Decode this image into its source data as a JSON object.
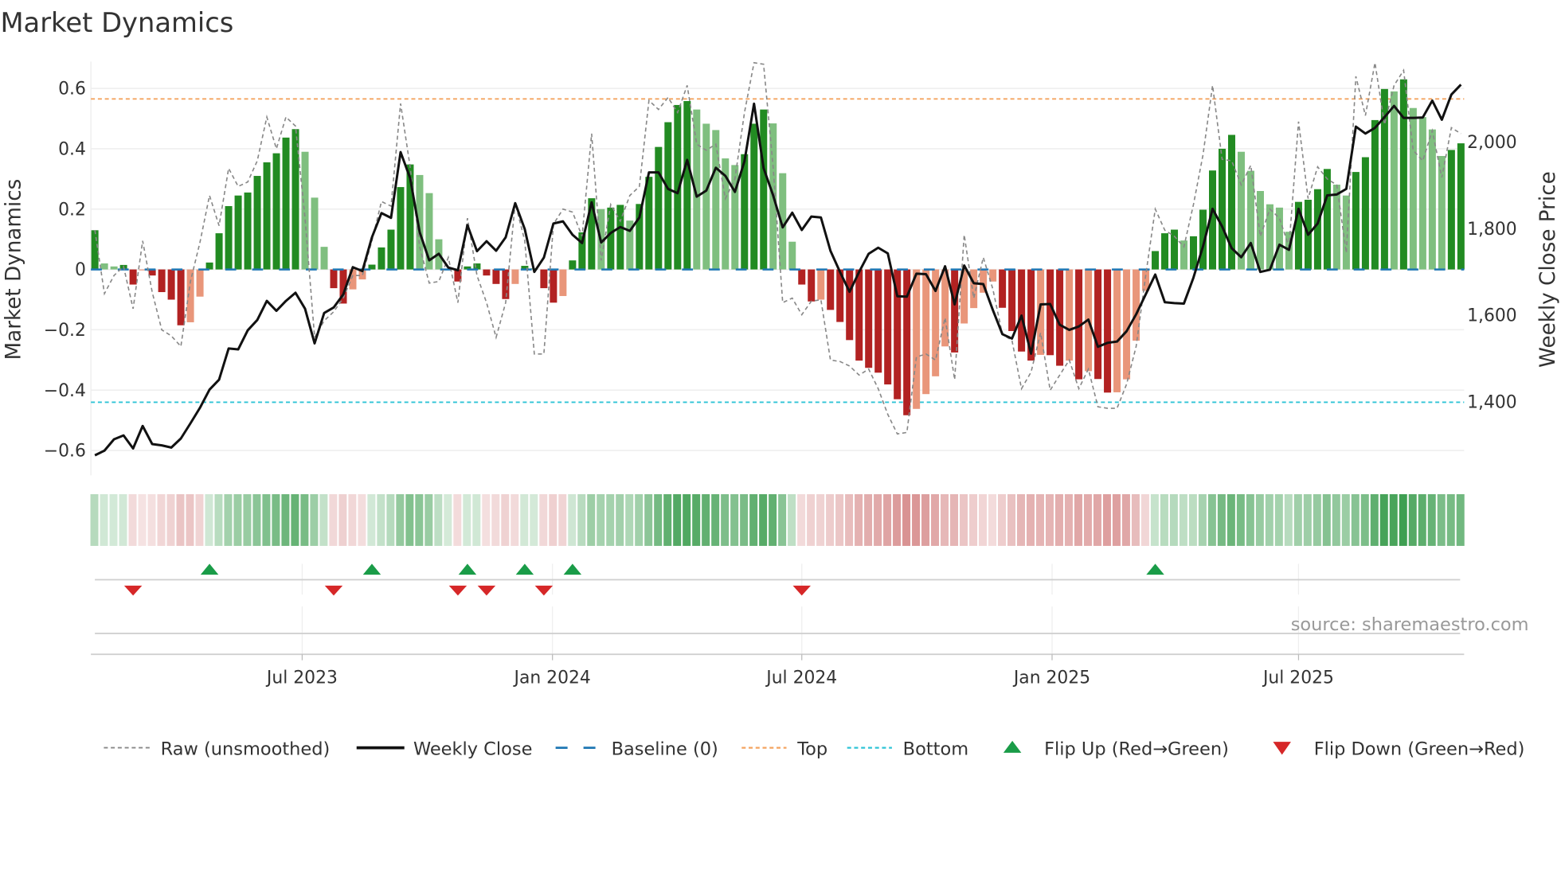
{
  "title": "Market Dynamics",
  "source": "source: sharemaestro.com",
  "colors": {
    "pos_strong": "#228b22",
    "pos_weak": "#7fbf7f",
    "neg_strong": "#b22222",
    "neg_weak": "#e9967a",
    "raw": "#888888",
    "close": "#111111",
    "baseline": "#1f77b4",
    "top": "#f4a460",
    "bottom": "#2ec4d6",
    "flip_up": "#1a9c48",
    "flip_down": "#d62728",
    "heat_pos": "#3f9f52",
    "heat_neg": "#c96464"
  },
  "legend": [
    {
      "key": "raw",
      "label": "Raw (unsmoothed)"
    },
    {
      "key": "close",
      "label": "Weekly Close"
    },
    {
      "key": "baseline",
      "label": "Baseline (0)"
    },
    {
      "key": "top",
      "label": "Top"
    },
    {
      "key": "bottom",
      "label": "Bottom"
    },
    {
      "key": "flip_up",
      "label": "Flip Up (Red→Green)"
    },
    {
      "key": "flip_down",
      "label": "Flip Down (Green→Red)"
    }
  ],
  "chart_data": {
    "type": "bar",
    "title": "Market Dynamics",
    "ylabel": "Market Dynamics",
    "y2label": "Weekly Close Price",
    "ylim": [
      -0.66,
      0.68
    ],
    "y_ticks": [
      "0.6",
      "0.4",
      "0.2",
      "0",
      "−0.2",
      "−0.4",
      "−0.6"
    ],
    "y_tick_values": [
      0.6,
      0.4,
      0.2,
      0,
      -0.2,
      -0.4,
      -0.6
    ],
    "y2_ticks": [
      "2,000",
      "1,800",
      "1,600",
      "1,400"
    ],
    "y2_tick_values": [
      2000,
      1800,
      1600,
      1400
    ],
    "x_ticks": [
      {
        "label": "Jul 2023",
        "week": 21.7
      },
      {
        "label": "Jan 2024",
        "week": 47.9
      },
      {
        "label": "Jul 2024",
        "week": 74.0
      },
      {
        "label": "Jan 2025",
        "week": 100.2
      },
      {
        "label": "Jul 2025",
        "week": 126.0
      }
    ],
    "top_level": 0.565,
    "bottom_level": -0.44,
    "baseline": 0,
    "grid": true,
    "legend_position": "bottom",
    "momentum": [
      0.13,
      0.02,
      0.01,
      0.015,
      -0.05,
      -0.003,
      -0.02,
      -0.075,
      -0.1,
      -0.185,
      -0.175,
      -0.09,
      0.023,
      0.12,
      0.21,
      0.245,
      0.255,
      0.31,
      0.355,
      0.385,
      0.437,
      0.465,
      0.39,
      0.238,
      0.075,
      -0.062,
      -0.113,
      -0.066,
      -0.033,
      0.016,
      0.073,
      0.132,
      0.273,
      0.348,
      0.313,
      0.253,
      0.1,
      0.003,
      -0.04,
      0.01,
      0.02,
      -0.02,
      -0.048,
      -0.098,
      -0.048,
      0.012,
      0.004,
      -0.062,
      -0.11,
      -0.088,
      0.03,
      0.123,
      0.236,
      0.2,
      0.205,
      0.214,
      0.162,
      0.217,
      0.307,
      0.406,
      0.488,
      0.545,
      0.558,
      0.53,
      0.483,
      0.462,
      0.368,
      0.346,
      0.382,
      0.483,
      0.53,
      0.484,
      0.319,
      0.092,
      -0.05,
      -0.106,
      -0.1,
      -0.134,
      -0.174,
      -0.234,
      -0.302,
      -0.326,
      -0.342,
      -0.381,
      -0.43,
      -0.483,
      -0.462,
      -0.413,
      -0.354,
      -0.255,
      -0.275,
      -0.179,
      -0.128,
      -0.077,
      -0.04,
      -0.127,
      -0.204,
      -0.272,
      -0.302,
      -0.283,
      -0.284,
      -0.319,
      -0.302,
      -0.364,
      -0.337,
      -0.363,
      -0.408,
      -0.407,
      -0.364,
      -0.236,
      -0.071,
      0.061,
      0.12,
      0.132,
      0.096,
      0.11,
      0.198,
      0.328,
      0.4,
      0.446,
      0.39,
      0.327,
      0.26,
      0.216,
      0.205,
      0.125,
      0.224,
      0.231,
      0.266,
      0.333,
      0.281,
      0.245,
      0.323,
      0.372,
      0.495,
      0.598,
      0.59,
      0.63,
      0.535,
      0.505,
      0.464,
      0.376,
      0.396,
      0.418
    ],
    "raw": [
      0.13,
      -0.08,
      -0.02,
      0.01,
      -0.13,
      0.095,
      -0.075,
      -0.2,
      -0.22,
      -0.255,
      -0.04,
      0.09,
      0.245,
      0.145,
      0.335,
      0.275,
      0.29,
      0.36,
      0.505,
      0.4,
      0.505,
      0.475,
      0.17,
      -0.225,
      -0.17,
      -0.14,
      -0.095,
      -0.02,
      -0.02,
      0.095,
      0.225,
      0.21,
      0.55,
      0.34,
      0.075,
      -0.045,
      -0.04,
      0.04,
      -0.11,
      0.17,
      -0.02,
      -0.11,
      -0.225,
      -0.11,
      0.22,
      0.095,
      -0.28,
      -0.28,
      0.15,
      0.2,
      0.19,
      0.11,
      0.45,
      0.03,
      0.215,
      0.16,
      0.245,
      0.275,
      0.56,
      0.53,
      0.57,
      0.52,
      0.61,
      0.415,
      0.395,
      0.415,
      0.235,
      0.3,
      0.52,
      0.685,
      0.68,
      0.34,
      -0.11,
      -0.095,
      -0.15,
      -0.105,
      -0.1,
      -0.3,
      -0.305,
      -0.32,
      -0.35,
      -0.33,
      -0.395,
      -0.48,
      -0.545,
      -0.54,
      -0.29,
      -0.28,
      -0.3,
      -0.16,
      -0.365,
      0.115,
      -0.095,
      0.04,
      -0.065,
      -0.215,
      -0.235,
      -0.395,
      -0.34,
      -0.21,
      -0.4,
      -0.35,
      -0.3,
      -0.395,
      -0.33,
      -0.455,
      -0.46,
      -0.46,
      -0.38,
      -0.255,
      -0.02,
      0.2,
      0.13,
      0.11,
      0.075,
      0.215,
      0.38,
      0.61,
      0.365,
      0.36,
      0.28,
      0.345,
      0.11,
      0.2,
      0.17,
      0.075,
      0.49,
      0.235,
      0.34,
      0.3,
      0.28,
      0.055,
      0.64,
      0.51,
      0.685,
      0.48,
      0.61,
      0.66,
      0.395,
      0.36,
      0.46,
      0.305,
      0.47,
      0.45
    ],
    "weekly_close": [
      1276,
      1287,
      1313,
      1322,
      1292,
      1344,
      1302,
      1299,
      1294,
      1315,
      1350,
      1386,
      1428,
      1451,
      1523,
      1521,
      1565,
      1589,
      1633,
      1610,
      1633,
      1652,
      1615,
      1535,
      1605,
      1618,
      1648,
      1711,
      1702,
      1780,
      1836,
      1825,
      1977,
      1917,
      1792,
      1727,
      1742,
      1710,
      1704,
      1808,
      1748,
      1771,
      1749,
      1780,
      1859,
      1799,
      1700,
      1733,
      1812,
      1817,
      1786,
      1767,
      1861,
      1768,
      1790,
      1804,
      1795,
      1826,
      1930,
      1930,
      1892,
      1882,
      1959,
      1874,
      1888,
      1941,
      1922,
      1885,
      1956,
      2089,
      1940,
      1877,
      1803,
      1837,
      1797,
      1828,
      1826,
      1749,
      1700,
      1654,
      1700,
      1742,
      1756,
      1743,
      1644,
      1643,
      1696,
      1695,
      1656,
      1713,
      1625,
      1715,
      1674,
      1672,
      1612,
      1556,
      1546,
      1599,
      1511,
      1625,
      1626,
      1578,
      1566,
      1574,
      1590,
      1527,
      1536,
      1539,
      1563,
      1602,
      1648,
      1694,
      1630,
      1628,
      1627,
      1687,
      1759,
      1846,
      1805,
      1755,
      1734,
      1767,
      1700,
      1705,
      1763,
      1751,
      1846,
      1786,
      1812,
      1877,
      1879,
      1892,
      2036,
      2020,
      2033,
      2058,
      2084,
      2056,
      2056,
      2057,
      2096,
      2052,
      2110,
      2133
    ],
    "flip_up_weeks": [
      12,
      29,
      39,
      45,
      50,
      111
    ],
    "flip_down_weeks": [
      4,
      25,
      38,
      41,
      47,
      74
    ]
  }
}
